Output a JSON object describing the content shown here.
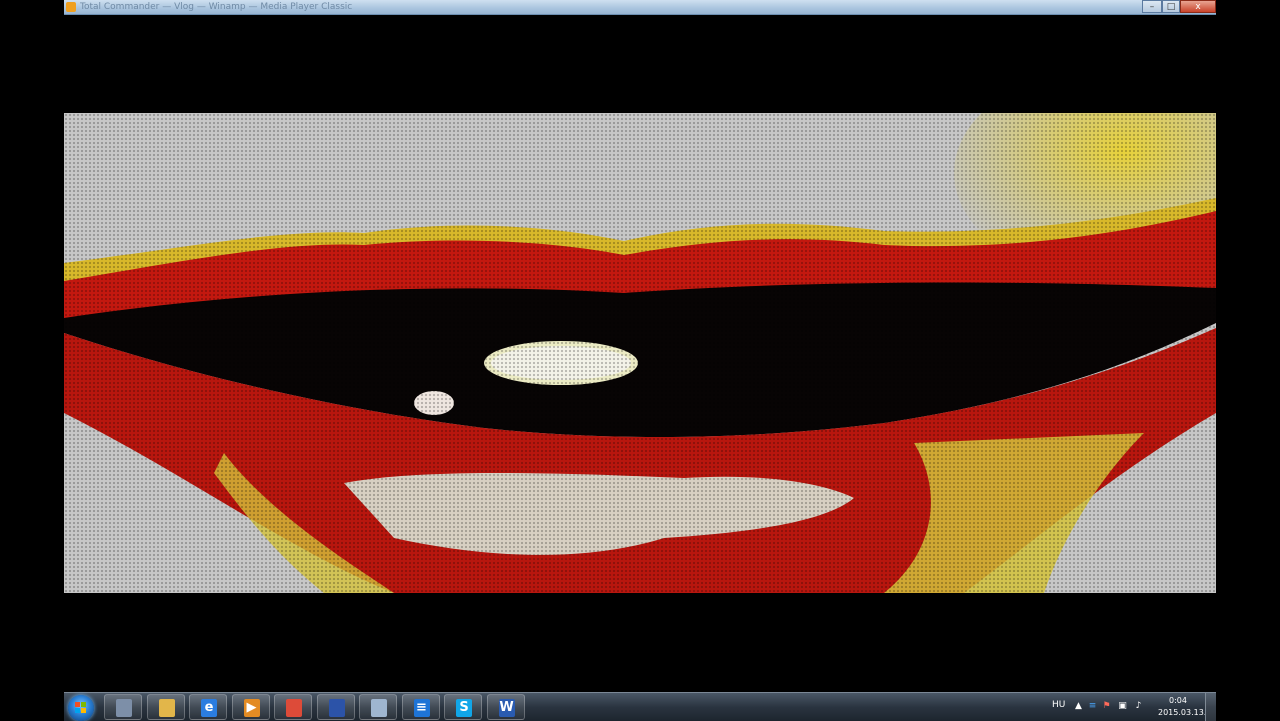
{
  "window": {
    "title": "Total Commander — Vlog — Winamp — Media Player Classic",
    "controls": {
      "minimize": "–",
      "maximize": "□",
      "close": "x"
    }
  },
  "taskbar": {
    "items": [
      {
        "name": "calculator",
        "glyph": "",
        "color": "#7d8fa8"
      },
      {
        "name": "folder",
        "glyph": "",
        "color": "#e2b64a"
      },
      {
        "name": "internet-explorer",
        "glyph": "e",
        "color": "#2b7de0"
      },
      {
        "name": "media-player",
        "glyph": "▶",
        "color": "#e38b23"
      },
      {
        "name": "chrome",
        "glyph": "",
        "color": "#dd4b39"
      },
      {
        "name": "save-disk",
        "glyph": "",
        "color": "#2c53a8"
      },
      {
        "name": "image-viewer",
        "glyph": "",
        "color": "#9fb6d0"
      },
      {
        "name": "stack-app",
        "glyph": "≡",
        "color": "#1e74d6"
      },
      {
        "name": "skype",
        "glyph": "S",
        "color": "#11a6e8"
      },
      {
        "name": "word",
        "glyph": "W",
        "color": "#2a5bb0"
      }
    ],
    "tray": {
      "language": "HU",
      "time": "0:04",
      "date": "2015.03.13."
    }
  }
}
